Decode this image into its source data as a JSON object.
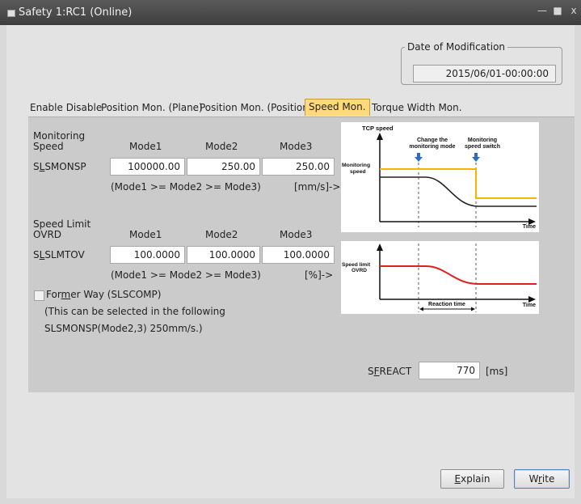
{
  "window": {
    "title": "Safety 1:RC1 (Online)"
  },
  "date_of_modification": {
    "label": "Date of Modification",
    "value": "2015/06/01-00:00:00"
  },
  "tabs": [
    {
      "label": "Enable Disable",
      "active": false
    },
    {
      "label": "Position Mon. (Plane)",
      "active": false
    },
    {
      "label": "Position Mon. (Position)",
      "active": false
    },
    {
      "label": "Speed Mon.",
      "active": true
    },
    {
      "label": "Torque Width Mon.",
      "active": false
    }
  ],
  "monitoring": {
    "header": [
      "Monitoring",
      "Speed"
    ],
    "mode_headers": [
      "Mode1",
      "Mode2",
      "Mode3"
    ],
    "param_prefix": "S",
    "param_ul": "L",
    "param_rest": "SMONSP",
    "values": [
      "100000.00",
      "250.00",
      "250.00"
    ],
    "rule": "(Mode1 >= Mode2 >= Mode3)",
    "unit": "[mm/s]->"
  },
  "ovrd": {
    "header": [
      "Speed Limit",
      "OVRD"
    ],
    "mode_headers": [
      "Mode1",
      "Mode2",
      "Mode3"
    ],
    "param_prefix": "S",
    "param_ul": "L",
    "param_rest": "SLMTOV",
    "values": [
      "100.0000",
      "100.0000",
      "100.0000"
    ],
    "rule": "(Mode1 >= Mode2 >= Mode3)",
    "unit": "[%]->"
  },
  "former_way": {
    "pre": "For",
    "ul": "m",
    "post": "er Way (SLSCOMP)",
    "checked": false,
    "note_line1": "(This can be selected in the following",
    "note_line2": "SLSMONSP(Mode2,3) 250mm/s.)"
  },
  "sfreact": {
    "pre": "S",
    "ul": "F",
    "post": "REACT",
    "value": "770",
    "unit": "[ms]"
  },
  "diagram1": {
    "y_title": "TCP speed",
    "change_l1": "Change the",
    "change_l2": "monitoring mode",
    "switch_l1": "Monitoring",
    "switch_l2": "speed switch",
    "left_l1": "Monitoring",
    "left_l2": "speed",
    "x_label": "Time",
    "colors": {
      "limit": "#f5b400",
      "actual": "#222222",
      "marker": "#2a6fc0"
    }
  },
  "diagram2": {
    "left_l1": "Speed limit",
    "left_l2": "OVRD",
    "reaction": "Reaction time",
    "x_label": "Time",
    "colors": {
      "line": "#e02020"
    }
  },
  "buttons": {
    "explain_ul": "E",
    "explain_rest": "xplain",
    "write_pre": "W",
    "write_ul": "r",
    "write_post": "ite"
  }
}
